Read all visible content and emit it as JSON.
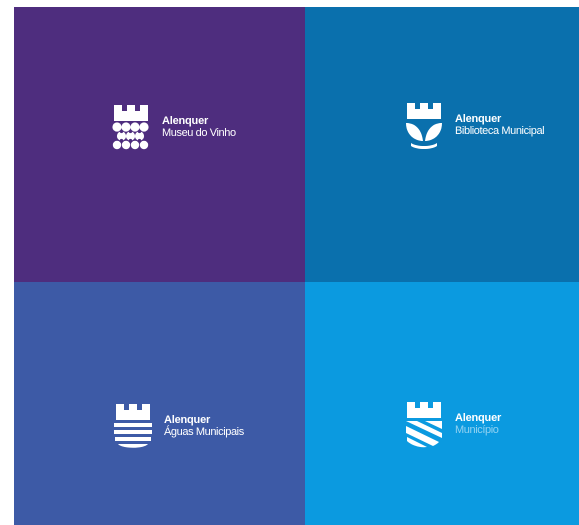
{
  "tiles": [
    {
      "id": "museu",
      "bg": "#4e2d7e",
      "brand": "Alenquer",
      "subtitle": "Museu do Vinho",
      "icon": "castle-grapes-icon"
    },
    {
      "id": "biblioteca",
      "bg": "#0a70ad",
      "brand": "Alenquer",
      "subtitle": "Biblioteca Municipal",
      "icon": "castle-book-icon"
    },
    {
      "id": "aguas",
      "bg": "#3d5aa6",
      "brand": "Alenquer",
      "subtitle": "Águas Municipais",
      "icon": "castle-waves-icon"
    },
    {
      "id": "municipio",
      "bg": "#0b9ae0",
      "brand": "Alenquer",
      "subtitle": "Município",
      "icon": "castle-stripes-icon"
    }
  ]
}
